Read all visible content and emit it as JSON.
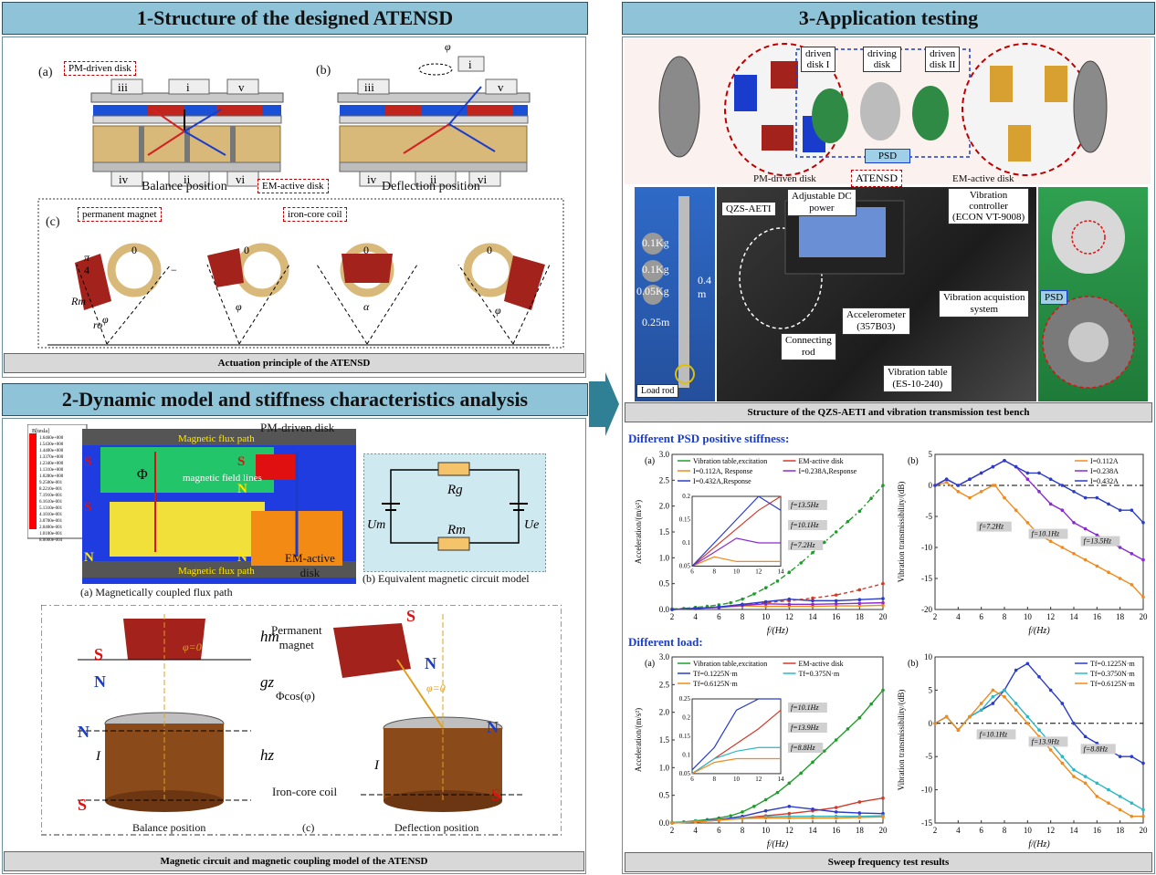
{
  "headers": {
    "h1": "1-Structure of the designed ATENSD",
    "h2": "2-Dynamic model and stiffness characteristics analysis",
    "h3": "3-Application testing"
  },
  "captions": {
    "c1": "Actuation principle of the ATENSD",
    "c2": "Magnetic circuit and magnetic coupling model of the ATENSD",
    "c3": "Structure of the QZS-AETI and vibration transmission test bench",
    "c4": "Sweep frequency test results"
  },
  "panel1": {
    "a": "(a)",
    "b": "(b)",
    "c": "(c)",
    "pm_disk": "PM-driven disk",
    "em_disk": "EM-active disk",
    "balance": "Balance position",
    "deflection": "Deflection position",
    "pm": "permanent magnet",
    "coil": "iron-core coil",
    "roman": [
      "iii",
      "i",
      "v",
      "iv",
      "ii",
      "vi"
    ],
    "zero": "0",
    "phi": "φ",
    "rm": "Rm",
    "ro": "ro",
    "alpha": "α",
    "pi4": "π",
    "four": "4",
    "minus": "−"
  },
  "panel2": {
    "pm_disk": "PM-driven disk",
    "flux_path": "Magnetic flux path",
    "field_lines": "magnetic\nfield lines",
    "em_active": "EM-active\ndisk",
    "cap_a": "(a) Magnetically coupled flux path",
    "cap_b": "(b) Equivalent magnetic circuit model",
    "cap_c": "(c)",
    "Rg": "Rg",
    "Rm": "Rm",
    "Um": "Um",
    "Ue": "Ue",
    "legend_title": "B[tesla]",
    "legend_values": [
      "1.6460e+000",
      "1.5430e+000",
      "1.4400e+000",
      "1.3370e+000",
      "1.2340e+000",
      "1.1310e+000",
      "1.0280e+000",
      "9.2500e-001",
      "8.2210e-001",
      "7.1910e-001",
      "6.1610e-001",
      "5.1310e-001",
      "4.1010e-001",
      "3.0700e-001",
      "2.0400e-001",
      "1.0100e-001",
      "8.0000e-004"
    ],
    "perm_magnet": "Permanent\nmagnet",
    "iron_coil": "Iron-core coil",
    "balance": "Balance position",
    "deflection": "Deflection position",
    "phi0": "φ=0",
    "phicos": "Φcos(φ)",
    "hm": "hm",
    "gz": "gz",
    "hz": "hz",
    "I": "I",
    "S": "S",
    "N": "N",
    "Phi": "Φ"
  },
  "panel3": {
    "driven1": "driven\ndisk I",
    "driving": "driving\ndisk",
    "driven2": "driven\ndisk II",
    "psd": "PSD",
    "atensd": "ATENSD",
    "pm_disk": "PM-driven disk",
    "em_disk": "EM-active disk",
    "qzs": "QZS-AETI",
    "dc_power": "Adjustable DC\npower",
    "controller": "Vibration\ncontroller\n(ECON VT-9008)",
    "acq": "Vibration acquistion\nsystem",
    "accel": "Accelerometer\n(357B03)",
    "rod": "Connecting\nrod",
    "table": "Vibration table\n(ES-10-240)",
    "load_rod": "Load rod",
    "m01a": "0.1Kg",
    "m01b": "0.1Kg",
    "m005": "0.05Kg",
    "l025": "0.25m",
    "l04": "0.4\nm"
  },
  "charts": {
    "title_top": "Different PSD positive stiffness:",
    "title_bottom": "Different load:",
    "a": "(a)",
    "b": "(b)",
    "xlabel": "f/(Hz)",
    "ylabel_acc": "Acceleration/(m/s²)",
    "ylabel_tr": "Vibration transmissibility/(dB)"
  },
  "chart_data": [
    {
      "type": "line",
      "title": "Different PSD positive stiffness:",
      "xlabel": "f/(Hz)",
      "ylabel": "Acceleration/(m/s²)",
      "xlim": [
        2,
        20
      ],
      "ylim": [
        0,
        3.0
      ],
      "xticks": [
        2,
        4,
        6,
        8,
        10,
        12,
        14,
        16,
        18,
        20
      ],
      "yticks": [
        0.0,
        0.5,
        1.0,
        1.5,
        2.0,
        2.5,
        3.0
      ],
      "legend": "top",
      "series": [
        {
          "name": "Vibration table,excitation",
          "color": "#1f9d2a",
          "dash": "6 3 2 3",
          "x": [
            2,
            3,
            4,
            5,
            6,
            7,
            8,
            9,
            10,
            11,
            12,
            13,
            14,
            15,
            16,
            17,
            18,
            19,
            20
          ],
          "y": [
            0.01,
            0.02,
            0.04,
            0.06,
            0.09,
            0.13,
            0.2,
            0.3,
            0.42,
            0.55,
            0.72,
            0.9,
            1.1,
            1.3,
            1.5,
            1.7,
            1.9,
            2.15,
            2.4
          ]
        },
        {
          "name": "EM-active disk",
          "color": "#d23a2a",
          "dash": "4 3",
          "x": [
            2,
            4,
            6,
            8,
            10,
            12,
            14,
            16,
            18,
            20
          ],
          "y": [
            0.0,
            0.02,
            0.05,
            0.09,
            0.13,
            0.17,
            0.22,
            0.28,
            0.38,
            0.5
          ]
        },
        {
          "name": "I=0.112A, Response",
          "color": "#f08a1c",
          "dash": "",
          "x": [
            2,
            4,
            6,
            8,
            10,
            12,
            14,
            16,
            18,
            20
          ],
          "y": [
            0.0,
            0.02,
            0.04,
            0.07,
            0.06,
            0.06,
            0.06,
            0.07,
            0.07,
            0.08
          ]
        },
        {
          "name": "I=0.238A,Response",
          "color": "#8a2bd0",
          "dash": "",
          "x": [
            2,
            4,
            6,
            8,
            10,
            12,
            14,
            16,
            18,
            20
          ],
          "y": [
            0.0,
            0.02,
            0.04,
            0.08,
            0.11,
            0.1,
            0.1,
            0.11,
            0.12,
            0.13
          ]
        },
        {
          "name": "I=0.432A,Response",
          "color": "#2a3cc8",
          "dash": "",
          "x": [
            2,
            4,
            6,
            8,
            10,
            12,
            14,
            16,
            18,
            20
          ],
          "y": [
            0.0,
            0.02,
            0.05,
            0.1,
            0.15,
            0.2,
            0.17,
            0.17,
            0.19,
            0.21
          ]
        }
      ],
      "annotations": [
        "f=13.5Hz",
        "f=10.1Hz",
        "f=7.2Hz"
      ],
      "inset": {
        "xlim": [
          6,
          14
        ],
        "ylim": [
          0.05,
          0.2
        ],
        "xticks": [
          6,
          8,
          10,
          12,
          14
        ],
        "yticks": [
          0.05,
          0.1,
          0.15,
          0.2
        ]
      }
    },
    {
      "type": "line",
      "title": "",
      "xlabel": "f/(Hz)",
      "ylabel": "Vibration transmissibility/(dB)",
      "xlim": [
        2,
        20
      ],
      "ylim": [
        -20,
        5
      ],
      "xticks": [
        2,
        4,
        6,
        8,
        10,
        12,
        14,
        16,
        18,
        20
      ],
      "yticks": [
        5,
        0,
        -5,
        -10,
        -15,
        -20
      ],
      "legend": "top-right",
      "series": [
        {
          "name": "I=0.112A",
          "color": "#f08a1c",
          "x": [
            2,
            3,
            4,
            5,
            6,
            7,
            7.2,
            8,
            9,
            10,
            11,
            12,
            13,
            14,
            15,
            16,
            17,
            18,
            19,
            20
          ],
          "y": [
            0,
            0.5,
            -1,
            -2,
            -1,
            0,
            0,
            -2,
            -4,
            -6,
            -8,
            -9,
            -10,
            -11,
            -12,
            -13,
            -14,
            -15,
            -16,
            -18
          ]
        },
        {
          "name": "I=0.238A",
          "color": "#8a2bd0",
          "x": [
            2,
            3,
            4,
            5,
            6,
            7,
            8,
            9,
            10,
            11,
            12,
            13,
            14,
            15,
            16,
            17,
            18,
            19,
            20
          ],
          "y": [
            0,
            1,
            0,
            1,
            2,
            3,
            4,
            3,
            1,
            -1,
            -3,
            -4,
            -6,
            -7,
            -8,
            -9,
            -10,
            -11,
            -12
          ]
        },
        {
          "name": "I=0.432A",
          "color": "#2a3cc8",
          "x": [
            2,
            3,
            4,
            5,
            6,
            7,
            8,
            9,
            10,
            11,
            12,
            13,
            14,
            15,
            16,
            17,
            18,
            19,
            20
          ],
          "y": [
            0,
            1,
            0,
            1,
            2,
            3,
            4,
            3,
            2,
            2,
            1,
            0,
            -1,
            -2,
            -2,
            -3,
            -4,
            -4,
            -6
          ]
        }
      ],
      "annotations": [
        "f=7.2Hz",
        "f=10.1Hz",
        "f=13.5Hz"
      ]
    },
    {
      "type": "line",
      "title": "Different load:",
      "xlabel": "f/(Hz)",
      "ylabel": "Acceleration/(m/s²)",
      "xlim": [
        2,
        20
      ],
      "ylim": [
        0,
        3.0
      ],
      "xticks": [
        2,
        4,
        6,
        8,
        10,
        12,
        14,
        16,
        18,
        20
      ],
      "yticks": [
        0.0,
        0.5,
        1.0,
        1.5,
        2.0,
        2.5,
        3.0
      ],
      "legend": "top",
      "series": [
        {
          "name": "Vibration table,excitation",
          "color": "#1f9d2a",
          "x": [
            2,
            3,
            4,
            5,
            6,
            7,
            8,
            9,
            10,
            11,
            12,
            13,
            14,
            15,
            16,
            17,
            18,
            19,
            20
          ],
          "y": [
            0.01,
            0.02,
            0.04,
            0.06,
            0.09,
            0.13,
            0.2,
            0.3,
            0.42,
            0.55,
            0.72,
            0.9,
            1.1,
            1.3,
            1.5,
            1.7,
            1.9,
            2.15,
            2.4
          ]
        },
        {
          "name": "EM-active disk",
          "color": "#d23a2a",
          "x": [
            2,
            4,
            6,
            8,
            10,
            12,
            14,
            16,
            18,
            20
          ],
          "y": [
            0.0,
            0.02,
            0.05,
            0.09,
            0.13,
            0.17,
            0.22,
            0.28,
            0.38,
            0.45
          ]
        },
        {
          "name": "Tf=0.1225N·m",
          "color": "#2a3cc8",
          "x": [
            2,
            4,
            6,
            8,
            10,
            12,
            14,
            16,
            18,
            20
          ],
          "y": [
            0.0,
            0.03,
            0.06,
            0.12,
            0.22,
            0.3,
            0.25,
            0.2,
            0.18,
            0.17
          ]
        },
        {
          "name": "Tf=0.375N·m",
          "color": "#2ab8c8",
          "x": [
            2,
            4,
            6,
            8,
            10,
            12,
            14,
            16,
            18,
            20
          ],
          "y": [
            0.0,
            0.03,
            0.05,
            0.09,
            0.11,
            0.12,
            0.12,
            0.12,
            0.12,
            0.13
          ]
        },
        {
          "name": "Tf=0.6125N·m",
          "color": "#f08a1c",
          "x": [
            2,
            4,
            6,
            8,
            10,
            12,
            14,
            16,
            18,
            20
          ],
          "y": [
            0.0,
            0.02,
            0.05,
            0.08,
            0.09,
            0.09,
            0.09,
            0.09,
            0.1,
            0.11
          ]
        }
      ],
      "annotations": [
        "f=10.1Hz",
        "f=13.9Hz",
        "f=8.8Hz"
      ],
      "inset": {
        "xlim": [
          6,
          14
        ],
        "ylim": [
          0.05,
          0.25
        ],
        "xticks": [
          6,
          8,
          10,
          12,
          14
        ],
        "yticks": [
          0.05,
          0.1,
          0.15,
          0.2,
          0.25
        ]
      }
    },
    {
      "type": "line",
      "title": "",
      "xlabel": "f/(Hz)",
      "ylabel": "Vibration transmissibility/(dB)",
      "xlim": [
        2,
        20
      ],
      "ylim": [
        -15,
        10
      ],
      "xticks": [
        2,
        4,
        6,
        8,
        10,
        12,
        14,
        16,
        18,
        20
      ],
      "yticks": [
        10,
        5,
        0,
        -5,
        -10,
        -15
      ],
      "legend": "top-right",
      "series": [
        {
          "name": "Tf=0.1225N·m",
          "color": "#2a3cc8",
          "x": [
            2,
            3,
            4,
            5,
            6,
            7,
            8,
            9,
            10,
            11,
            12,
            13,
            14,
            15,
            16,
            17,
            18,
            19,
            20
          ],
          "y": [
            0,
            1,
            -1,
            1,
            2,
            3,
            5,
            8,
            9,
            7,
            5,
            3,
            0,
            -2,
            -3,
            -4,
            -5,
            -5,
            -6
          ]
        },
        {
          "name": "Tf=0.3750N·m",
          "color": "#2ab8c8",
          "x": [
            2,
            3,
            4,
            5,
            6,
            7,
            8,
            9,
            10,
            11,
            12,
            13,
            14,
            15,
            16,
            17,
            18,
            19,
            20
          ],
          "y": [
            0,
            1,
            -1,
            1,
            2,
            4,
            5,
            3,
            1,
            -1,
            -3,
            -5,
            -7,
            -8,
            -9,
            -10,
            -11,
            -12,
            -13
          ]
        },
        {
          "name": "Tf=0.6125N·m",
          "color": "#f08a1c",
          "x": [
            2,
            3,
            4,
            5,
            6,
            7,
            8,
            9,
            10,
            11,
            12,
            13,
            14,
            15,
            16,
            17,
            18,
            19,
            20
          ],
          "y": [
            0,
            1,
            -1,
            1,
            3,
            5,
            4,
            2,
            0,
            -2,
            -4,
            -6,
            -8,
            -9,
            -11,
            -12,
            -13,
            -14,
            -14
          ]
        }
      ],
      "annotations": [
        "f=10.1Hz",
        "f=13.9Hz",
        "f=8.8Hz"
      ]
    }
  ],
  "colors": {
    "header_bg": "#8fc3d8",
    "magnet_red": "#a3221b",
    "coil_tan": "#d8b97a",
    "arrow_teal": "#2f7f95"
  }
}
